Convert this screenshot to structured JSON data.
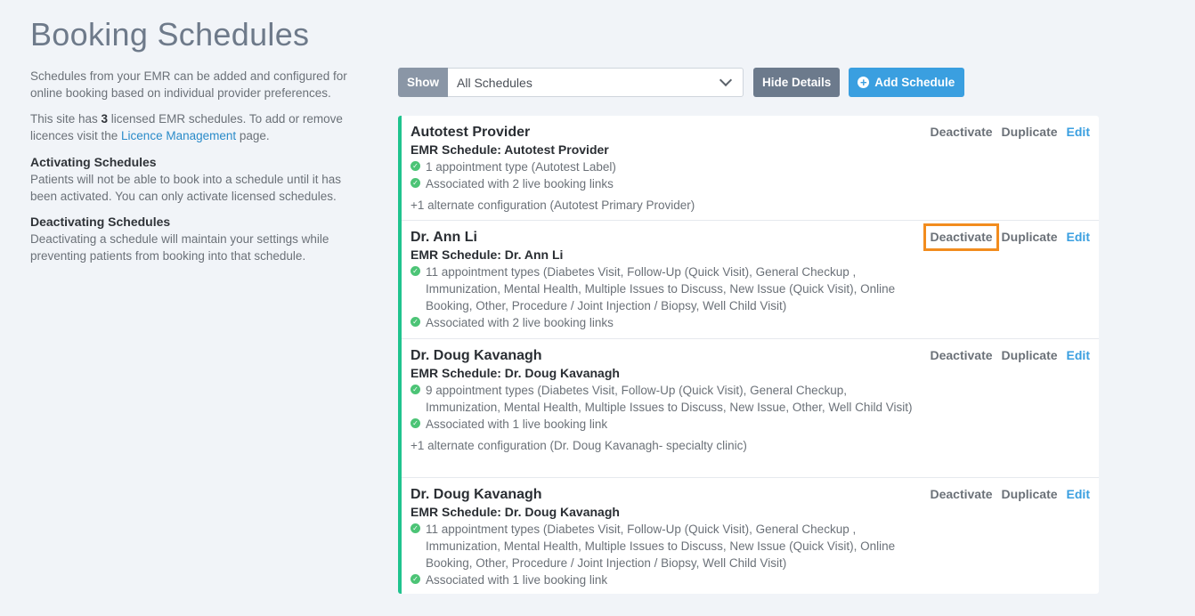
{
  "page": {
    "title": "Booking Schedules"
  },
  "sidebar": {
    "intro": "Schedules from your EMR can be added and configured for online booking based on individual provider preferences.",
    "licence_prefix": "This site has ",
    "licence_count": "3",
    "licence_mid": " licensed EMR schedules. To add or remove licences visit the ",
    "licence_link": "Licence Management",
    "licence_suffix": " page.",
    "activating_title": "Activating Schedules",
    "activating_text": "Patients will not be able to book into a schedule until it has been activated. You can only activate licensed schedules.",
    "deactivating_title": "Deactivating Schedules",
    "deactivating_text": "Deactivating a schedule will maintain your settings while preventing patients from booking into that schedule."
  },
  "toolbar": {
    "show_label": "Show",
    "filter_value": "All Schedules",
    "hide_details_label": "Hide Details",
    "add_schedule_label": "Add Schedule"
  },
  "actions": {
    "deactivate": "Deactivate",
    "duplicate": "Duplicate",
    "edit": "Edit"
  },
  "schedules": [
    {
      "name": "Autotest Provider",
      "emr": "EMR Schedule: Autotest Provider",
      "appointments": "1 appointment type (Autotest Label)",
      "links": "Associated with 2 live booking links",
      "alternate": "+1 alternate configuration (Autotest Primary Provider)"
    },
    {
      "name": "Dr. Ann Li",
      "emr": "EMR Schedule: Dr. Ann Li",
      "appointments": "11 appointment types (Diabetes Visit, Follow-Up (Quick Visit), General Checkup , Immunization, Mental Health, Multiple Issues to Discuss, New Issue (Quick Visit), Online Booking, Other, Procedure / Joint Injection / Biopsy, Well Child Visit)",
      "links": "Associated with 2 live booking links"
    },
    {
      "name": "Dr. Doug Kavanagh",
      "emr": "EMR Schedule: Dr. Doug Kavanagh",
      "appointments": "9 appointment types (Diabetes Visit, Follow-Up (Quick Visit), General Checkup, Immunization, Mental Health, Multiple Issues to Discuss, New Issue, Other, Well Child Visit)",
      "links": "Associated with 1 live booking link",
      "alternate": "+1 alternate configuration (Dr. Doug Kavanagh- specialty clinic)"
    },
    {
      "name": "Dr. Doug Kavanagh",
      "emr": "EMR Schedule: Dr. Doug Kavanagh",
      "appointments": "11 appointment types (Diabetes Visit, Follow-Up (Quick Visit), General Checkup , Immunization, Mental Health, Multiple Issues to Discuss, New Issue (Quick Visit), Online Booking, Other, Procedure / Joint Injection / Biopsy, Well Child Visit)",
      "links": "Associated with 1 live booking link"
    }
  ]
}
